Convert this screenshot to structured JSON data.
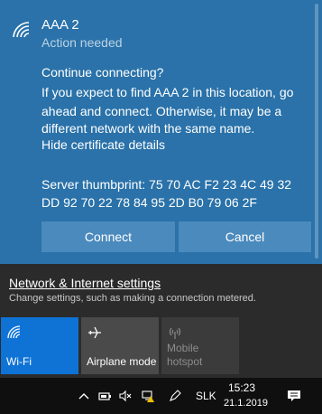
{
  "network": {
    "name": "AAA 2",
    "status": "Action needed",
    "message_lines": [
      "Continue connecting?",
      "If you expect to find AAA 2 in this location, go",
      "ahead and connect. Otherwise, it may be a",
      "different network with the same name.",
      "Hide certificate details"
    ],
    "thumbprint_lines": [
      "Server thumbprint: 75 70 AC F2 23 4C 49 32",
      "DD 92 70 22 78 84 95 2D B0 79 06 2F"
    ],
    "connect_label": "Connect",
    "cancel_label": "Cancel"
  },
  "settings": {
    "link_label": "Network & Internet settings",
    "description": "Change settings, such as making a connection metered."
  },
  "quick_actions": [
    {
      "label": "Wi-Fi",
      "icon": "wifi-icon",
      "state": "on"
    },
    {
      "label": "Airplane mode",
      "icon": "airplane-icon",
      "state": "off"
    },
    {
      "label_lines": [
        "Mobile",
        "hotspot"
      ],
      "icon": "hotspot-icon",
      "state": "disabled"
    }
  ],
  "taskbar": {
    "language": "SLK",
    "time": "15:23",
    "date": "21.1.2019",
    "icons": [
      "chevron-up-icon",
      "battery-icon",
      "volume-muted-icon",
      "network-warning-icon",
      "pen-icon",
      "notifications-icon"
    ]
  },
  "colors": {
    "panel": "#2a72a9",
    "button": "#4b8abd",
    "tile_active": "#0f73d6",
    "tile_inactive": "#4a4a4a",
    "taskbar": "#0f0f0f"
  }
}
